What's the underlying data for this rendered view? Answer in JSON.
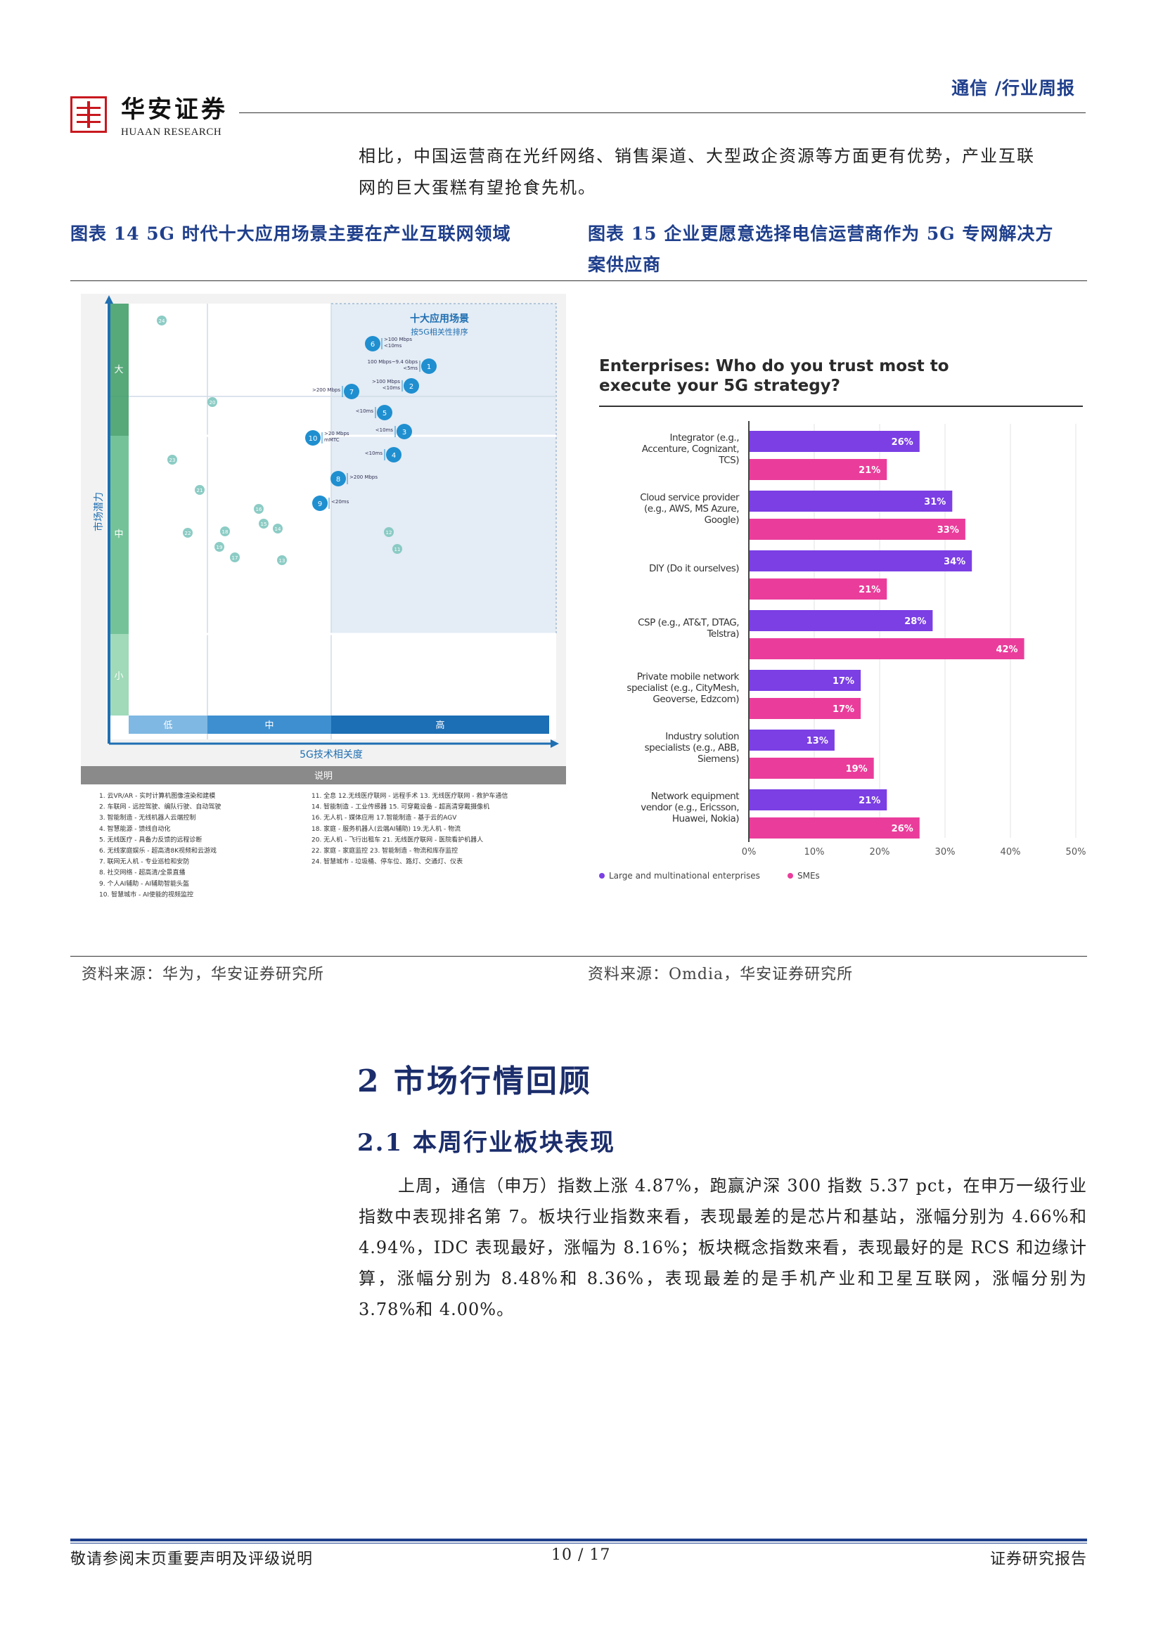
{
  "header": {
    "logo_cn": "华安证券",
    "logo_en": "HUAAN RESEARCH",
    "tag": "通信 /行业周报"
  },
  "intro": {
    "line1": "相比，中国运营商在光纤网络、销售渠道、大型政企资源等方面更有优势，产业互联",
    "line2": "网的巨大蛋糕有望抢食先机。"
  },
  "fig14": {
    "title": "图表 14 5G 时代十大应用场景主要在产业互联网领域",
    "box_title": "十大应用场景",
    "box_subtitle": "按5G相关性排序",
    "y_axis": "市场潜力",
    "y_levels": [
      "大",
      "中",
      "小"
    ],
    "x_axis": "5G技术相关度",
    "x_levels": [
      "低",
      "中",
      "高"
    ],
    "legend_header": "说明",
    "legend_col1": [
      "1. 云VR/AR - 实时计算机图像渲染和建模",
      "2. 车联网 - 远控驾驶、编队行驶、自动驾驶",
      "3. 智能制造 - 无线机器人云端控制",
      "4. 智慧能源 - 馈线自动化",
      "5. 无线医疗 - 具备力反馈的远程诊断",
      "6. 无线家庭娱乐 - 超高清8K视频和云游戏",
      "7. 联网无人机 - 专业巡检和安防",
      "8. 社交网络 - 超高清/全景直播",
      "9. 个人AI辅助 - AI辅助智能头盔",
      "10. 智慧城市 - AI使能的视频监控"
    ],
    "legend_col2": [
      "11. 全息  12.无线医疗联网 - 远程手术  13. 无线医疗联网 - 救护车通信",
      "14. 智能制造 - 工业传感器  15. 可穿戴设备 - 超高清穿戴摄像机",
      "16. 无人机 - 媒体应用  17.智能制造 - 基于云的AGV",
      "18. 家庭 - 服务机器人(云端AI辅助)  19.无人机 - 物流",
      "20. 无人机 - 飞行出租车  21. 无线医疗联网 - 医院看护机器人",
      "22. 家庭 - 家庭监控  23. 智能制造 - 物流和库存监控",
      "24. 智慧城市 - 垃圾桶、停车位、路灯、交通灯、仪表"
    ],
    "bubbles": [
      {
        "n": "6",
        "label": ">100 Mbps\n<10ms"
      },
      {
        "n": "1",
        "label": "100 Mbps~9.4 Gbps\n<5ms"
      },
      {
        "n": "2",
        "label": ">100 Mbps\n<10ms"
      },
      {
        "n": "7",
        "label": ">200 Mbps"
      },
      {
        "n": "5",
        "label": "<10ms"
      },
      {
        "n": "3",
        "label": "<10ms"
      },
      {
        "n": "10",
        "label": ">20 Mbps\nmMTC"
      },
      {
        "n": "4",
        "label": "<10ms"
      },
      {
        "n": "8",
        "label": ">200 Mbps"
      },
      {
        "n": "9",
        "label": "<20ms"
      }
    ],
    "small_bubbles": [
      "24",
      "20",
      "23",
      "21",
      "16",
      "15",
      "14",
      "22",
      "18",
      "19",
      "17",
      "13",
      "12",
      "11"
    ],
    "source": "资料来源：华为，华安证券研究所"
  },
  "fig15": {
    "title_line1": "图表 15 企业更愿意选择电信运营商作为 5G 专网解决方",
    "title_line2": "案供应商",
    "source": "资料来源：Omdia，华安证券研究所",
    "chart_data": {
      "type": "bar",
      "orientation": "horizontal",
      "title": "Enterprises: Who do you trust most to execute your 5G strategy?",
      "categories": [
        "Integrator (e.g., Accenture, Cognizant, TCS)",
        "Cloud service provider (e.g., AWS, MS Azure, Google)",
        "DIY (Do it ourselves)",
        "CSP (e.g., AT&T, DTAG, Telstra)",
        "Private mobile network specialist (e.g., CityMesh, Geoverse, Edzcom)",
        "Industry solution specialists (e.g., ABB, Siemens)",
        "Network equipment vendor (e.g., Ericsson, Huawei, Nokia)"
      ],
      "category_lines": [
        [
          "Integrator (e.g.,",
          "Accenture, Cognizant,",
          "TCS)"
        ],
        [
          "Cloud service provider",
          "(e.g., AWS, MS Azure,",
          "Google)"
        ],
        [
          "DIY (Do it ourselves)"
        ],
        [
          "CSP (e.g., AT&T, DTAG,",
          "Telstra)"
        ],
        [
          "Private mobile network",
          "specialist (e.g., CityMesh,",
          "Geoverse, Edzcom)"
        ],
        [
          "Industry solution",
          "specialists (e.g., ABB,",
          "Siemens)"
        ],
        [
          "Network equipment",
          "vendor (e.g., Ericsson,",
          "Huawei, Nokia)"
        ]
      ],
      "series": [
        {
          "name": "Large and multinational enterprises",
          "color": "#7b3fe4",
          "values": [
            26,
            31,
            34,
            28,
            17,
            13,
            21
          ]
        },
        {
          "name": "SMEs",
          "color": "#ea3d9b",
          "values": [
            21,
            33,
            21,
            42,
            17,
            19,
            26
          ]
        }
      ],
      "xlim": [
        0,
        50
      ],
      "xticks": [
        "0%",
        "10%",
        "20%",
        "30%",
        "40%",
        "50%"
      ],
      "legend": "bottom"
    }
  },
  "section": {
    "h1": "2 市场行情回顾",
    "h2": "2.1 本周行业板块表现",
    "body": "上周，通信（申万）指数上涨 4.87%，跑赢沪深 300 指数 5.37 pct，在申万一级行业指数中表现排名第 7。板块行业指数来看，表现最差的是芯片和基站，涨幅分别为 4.66%和 4.94%，IDC 表现最好，涨幅为 8.16%；板块概念指数来看，表现最好的是 RCS 和边缘计算，涨幅分别为 8.48%和 8.36%，表现最差的是手机产业和卫星互联网，涨幅分别为 3.78%和 4.00%。"
  },
  "footer": {
    "left": "敬请参阅末页重要声明及评级说明",
    "page": "10 / 17",
    "right": "证券研究报告"
  }
}
